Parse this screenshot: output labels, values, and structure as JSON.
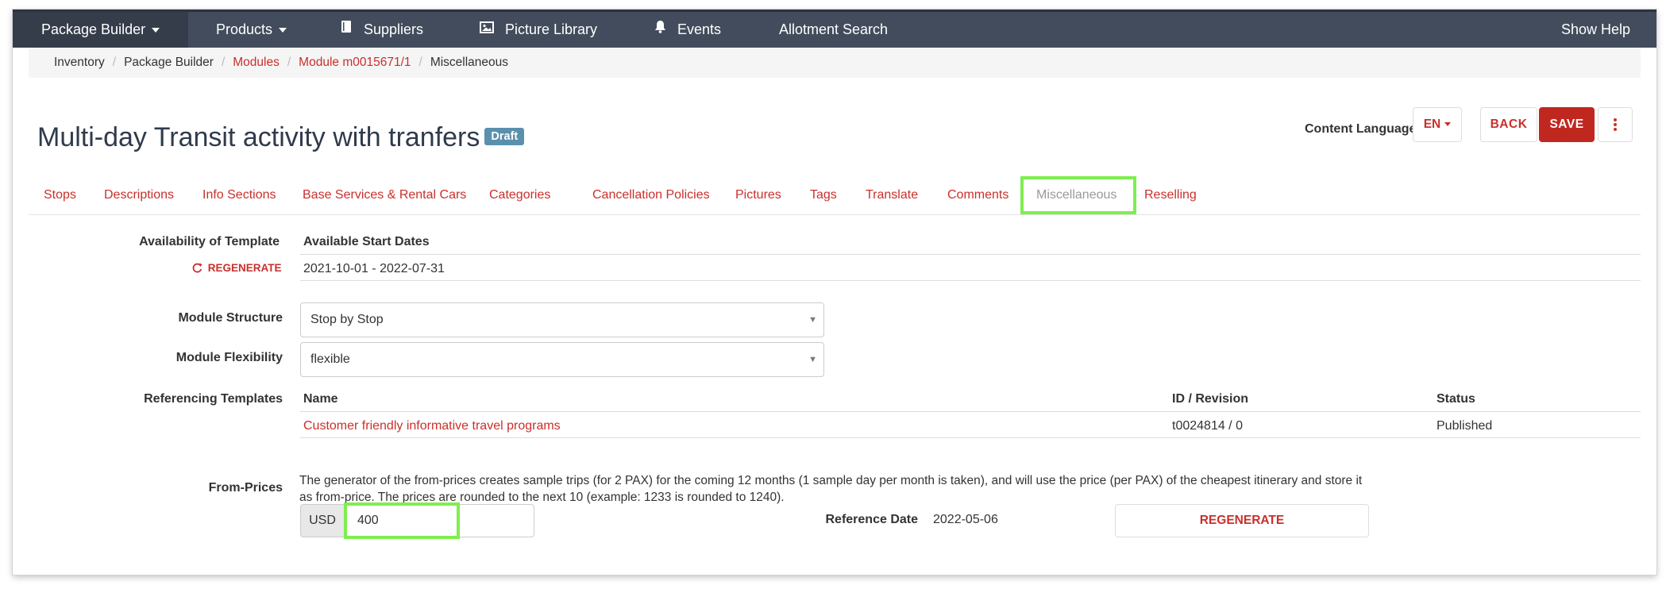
{
  "nav": {
    "package_builder": "Package Builder",
    "products": "Products",
    "suppliers": "Suppliers",
    "picture_library": "Picture Library",
    "events": "Events",
    "allotment_search": "Allotment Search",
    "show_help": "Show Help"
  },
  "breadcrumb": [
    "Inventory",
    "Package Builder",
    "Modules",
    "Module m0015671/1",
    "Miscellaneous"
  ],
  "page": {
    "title": "Multi-day Transit activity with tranfers",
    "status_badge": "Draft",
    "content_language_label": "Content Language",
    "content_language_value": "EN",
    "back_label": "BACK",
    "save_label": "SAVE"
  },
  "tabs": [
    "Stops",
    "Descriptions",
    "Info Sections",
    "Base Services & Rental Cars",
    "Categories",
    "Cancellation Policies",
    "Pictures",
    "Tags",
    "Translate",
    "Comments",
    "Miscellaneous",
    "Reselling"
  ],
  "availability": {
    "label": "Availability of Template",
    "regenerate": "REGENERATE",
    "header": "Available Start Dates",
    "value": "2021-10-01 - 2022-07-31"
  },
  "module_structure": {
    "label": "Module Structure",
    "value": "Stop by Stop"
  },
  "module_flexibility": {
    "label": "Module Flexibility",
    "value": "flexible"
  },
  "referencing_templates": {
    "label": "Referencing Templates",
    "headers": [
      "Name",
      "ID / Revision",
      "Status"
    ],
    "rows": [
      {
        "name": "Customer friendly informative travel programs",
        "id": "t0024814 / 0",
        "status": "Published"
      }
    ]
  },
  "from_prices": {
    "label": "From-Prices",
    "description": "The generator of the from-prices creates sample trips (for 2 PAX) for the coming 12 months (1 sample day per month is taken), and will use the price (per PAX) of the cheapest itinerary and store it as from-price. The prices are rounded to the next 10 (example: 1233 is rounded to 1240).",
    "currency": "USD",
    "price": "400",
    "reference_date_label": "Reference Date",
    "reference_date": "2022-05-06",
    "regenerate": "REGENERATE"
  },
  "colors": {
    "nav_bg": "#424c5c",
    "accent_red": "#c9302c",
    "highlight_green": "#7fee4e",
    "badge_blue": "#5b8fae"
  }
}
